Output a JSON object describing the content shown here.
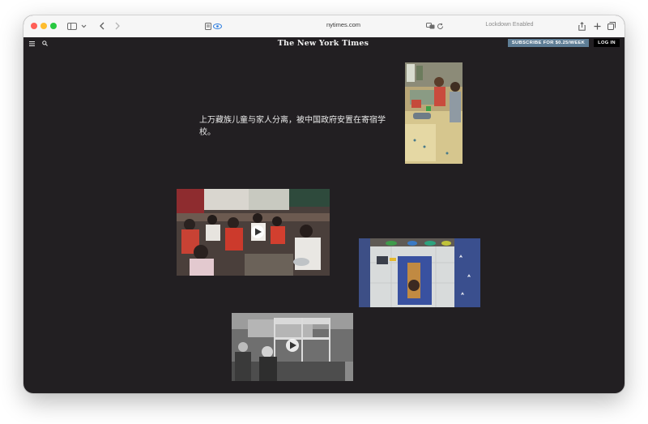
{
  "browser": {
    "url": "nytimes.com",
    "lockdown_label": "Lockdown Enabled",
    "icons": [
      "sidebar-icon",
      "chevron-down-icon",
      "back-icon",
      "forward-icon",
      "reader-icon",
      "privacy-icon",
      "translate-icon",
      "reload-icon",
      "share-icon",
      "new-tab-icon",
      "tabs-icon"
    ]
  },
  "nyt": {
    "masthead": "The New York Times",
    "subscribe_label": "SUBSCRIBE FOR $0.25/WEEK",
    "login_label": "LOG IN",
    "icons": [
      "menu-icon",
      "search-icon"
    ]
  },
  "article": {
    "headline": "上万藏族儿童与家人分离，被中国政府安置在寄宿学校。"
  },
  "photos": [
    {
      "name": "photo-children-washing"
    },
    {
      "name": "photo-classroom-meal",
      "has_video": true
    },
    {
      "name": "photo-child-on-mattress"
    },
    {
      "name": "photo-dormitory-bunks",
      "has_video": true
    }
  ],
  "colors": {
    "page_bg": "#221f22",
    "subscribe_bg": "#5e7d95",
    "login_bg": "#000000"
  }
}
